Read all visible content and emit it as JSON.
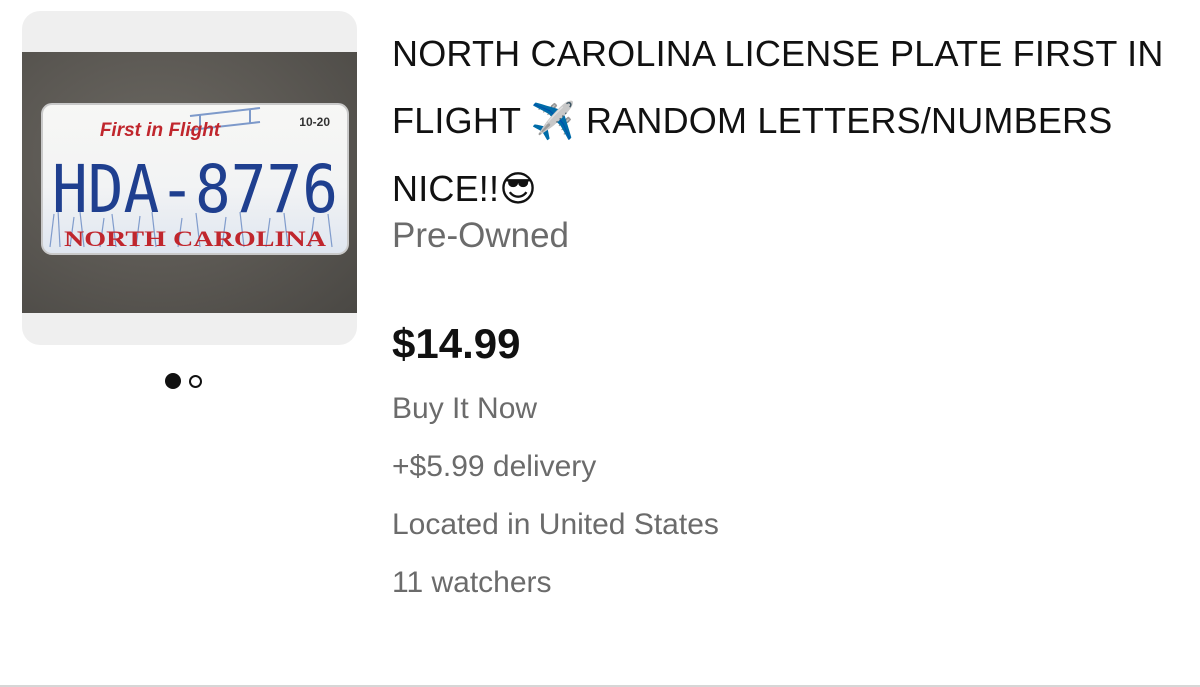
{
  "listing": {
    "title_part1": "NORTH CAROLINA LICENSE PLATE FIRST IN FLIGHT ",
    "title_emoji1": "✈️",
    "title_part2": " RANDOM LETTERS/NUMBERS NICE!!",
    "title_emoji2": "😎",
    "condition": "Pre-Owned",
    "price": "$14.99",
    "buy_format": "Buy It Now",
    "delivery": "+$5.99 delivery",
    "location": "Located in United States",
    "watchers": "11 watchers"
  },
  "image": {
    "plate_slogan": "First in Flight",
    "plate_sticker": "10-20",
    "plate_number": "HDA-8776",
    "plate_state": "NORTH CAROLINA"
  },
  "carousel": {
    "total": 2,
    "active_index": 1
  },
  "colors": {
    "plate_blue": "#1f3f8f",
    "plate_red": "#c0262d",
    "secondary_text": "#6b6b6b"
  }
}
